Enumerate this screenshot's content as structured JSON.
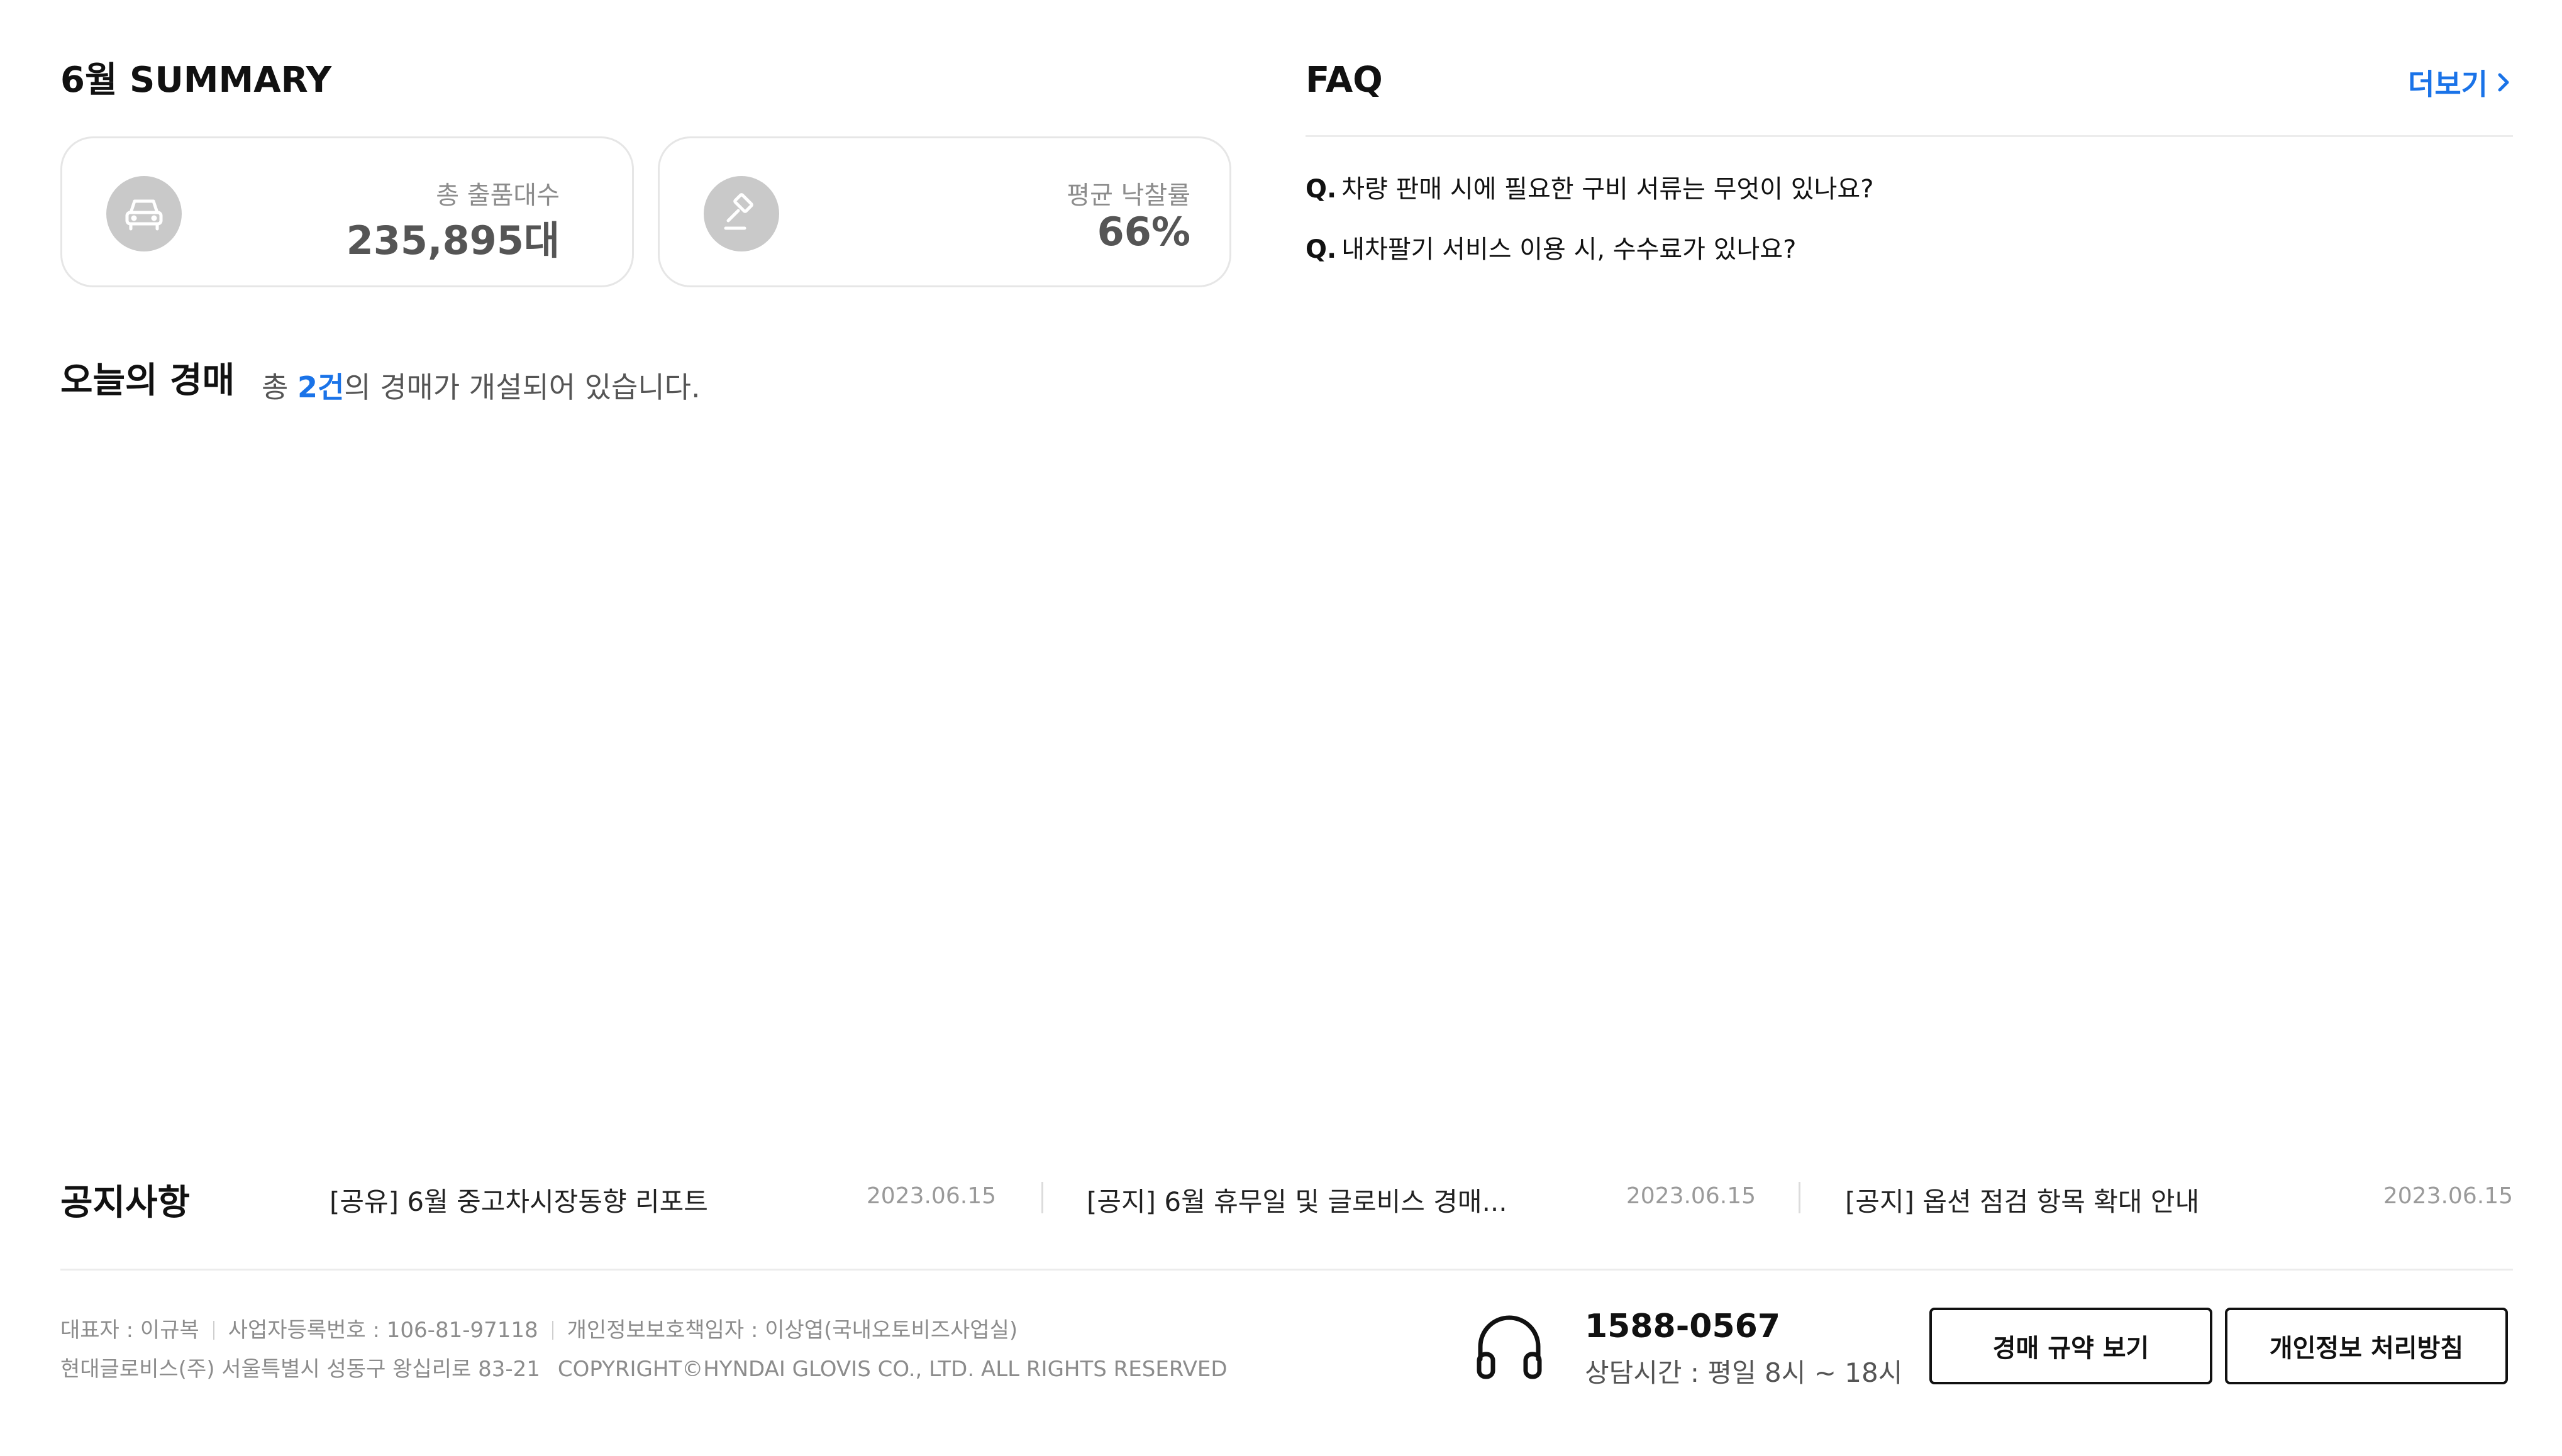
{
  "summary": {
    "title": "6월 SUMMARY",
    "cards": [
      {
        "icon": "car-icon",
        "label": "총 출품대수",
        "value": "235,895대"
      },
      {
        "icon": "gavel-icon",
        "label": "평균 낙찰률",
        "value": "66%"
      }
    ]
  },
  "today_auction": {
    "title": "오늘의 경매",
    "prefix": "총 ",
    "count": "2건",
    "suffix": "의 경매가 개설되어 있습니다."
  },
  "faq": {
    "title": "FAQ",
    "more_label": "더보기",
    "items": [
      {
        "q": "Q.",
        "text": "차량 판매 시에 필요한 구비 서류는 무엇이 있나요?"
      },
      {
        "q": "Q.",
        "text": "내차팔기 서비스 이용 시, 수수료가 있나요?"
      }
    ]
  },
  "notice": {
    "title": "공지사항",
    "items": [
      {
        "text": "[공유] 6월 중고차시장동향 리포트",
        "date": "2023.06.15"
      },
      {
        "text": "[공지] 6월 휴무일 및 글로비스 경매...",
        "date": "2023.06.15"
      },
      {
        "text": "[공지] 옵션 점검 항목 확대 안내",
        "date": "2023.06.15"
      }
    ]
  },
  "footer": {
    "ceo": "대표자 : 이규복",
    "biz_no": "사업자등록번호 : 106-81-97118",
    "privacy_officer": "개인정보보호책임자 : 이상엽(국내오토비즈사업실)",
    "address": "현대글로비스(주) 서울특별시 성동구 왕십리로 83-21",
    "copyright": "COPYRIGHT©HYNDAI GLOVIS CO., LTD. ALL RIGHTS RESERVED",
    "phone": "1588-0567",
    "hours": "상담시간 : 평일 8시 ~ 18시",
    "buttons": {
      "auction_rules": "경매 규약 보기",
      "privacy_policy": "개인정보 처리방침"
    }
  },
  "colors": {
    "accent": "#1a73e8",
    "icon_bg": "#c9c9c9"
  }
}
